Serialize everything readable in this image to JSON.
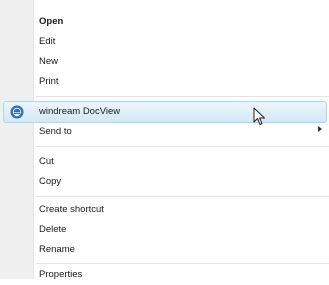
{
  "context_menu": {
    "items": [
      {
        "label": "Open",
        "bold": true
      },
      {
        "label": "Edit"
      },
      {
        "label": "New"
      },
      {
        "label": "Print"
      },
      {
        "label": "windream DocView",
        "icon": "windream-app-icon",
        "highlighted": true
      },
      {
        "label": "Send to",
        "submenu": true
      },
      {
        "label": "Cut"
      },
      {
        "label": "Copy"
      },
      {
        "label": "Create shortcut"
      },
      {
        "label": "Delete"
      },
      {
        "label": "Rename"
      },
      {
        "label": "Properties"
      }
    ]
  },
  "colors": {
    "gutter": "#f0f0f0",
    "separator": "#e2e3e3",
    "highlight_border": "#a8d8eb",
    "highlight_fill": "#d3e9f6",
    "text": "#1a1a1a",
    "app_icon": "#2f6fba"
  }
}
